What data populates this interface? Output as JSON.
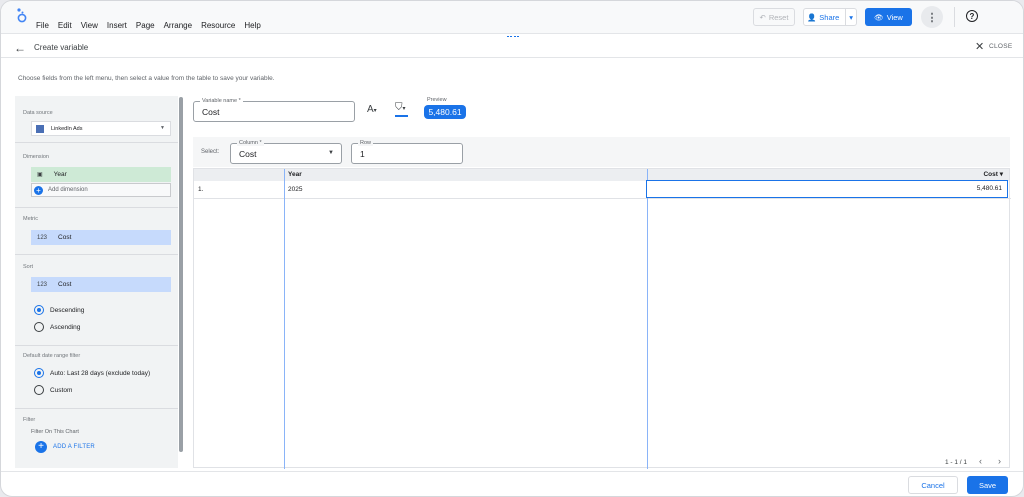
{
  "menu": [
    "File",
    "Edit",
    "View",
    "Insert",
    "Page",
    "Arrange",
    "Resource",
    "Help"
  ],
  "toolbar": {
    "reset": "Reset",
    "share": "Share",
    "view": "View",
    "help": "?"
  },
  "header": {
    "title": "Create variable",
    "close": "CLOSE"
  },
  "instructions": "Choose fields from the left menu, then select a value from the table to save your variable.",
  "left": {
    "data_source_label": "Data source",
    "data_source_value": "LinkedIn Ads",
    "dimension_label": "Dimension",
    "dimension_chip": "Year",
    "add_dimension": "Add dimension",
    "metric_label": "Metric",
    "metric_chip": "Cost",
    "sort_label": "Sort",
    "sort_chip": "Cost",
    "sort_desc": "Descending",
    "sort_asc": "Ascending",
    "date_label": "Default date range filter",
    "date_auto": "Auto",
    "date_auto_detail": "Last 28 days (exclude today)",
    "date_custom": "Custom",
    "filter_label": "Filter",
    "filter_sub": "Filter On This Chart",
    "add_filter": "ADD A FILTER",
    "type_badge": "123"
  },
  "editor": {
    "var_name_label": "Variable name *",
    "var_name_value": "Cost",
    "text_tool": "A",
    "preview_label": "Preview",
    "preview_value": "5,480.61",
    "select_label": "Select:",
    "column_label": "Column *",
    "column_value": "Cost",
    "row_label": "Row",
    "row_value": "1"
  },
  "table": {
    "headers": [
      "Year",
      "Cost ▾"
    ],
    "rows": [
      {
        "index": "1.",
        "year": "2025",
        "cost": "5,480.61"
      }
    ]
  },
  "pagination": "1 - 1 / 1",
  "footer": {
    "cancel": "Cancel",
    "save": "Save"
  },
  "colors": {
    "accent": "#1a73e8",
    "dimension_chip": "#ceead6",
    "metric_chip": "#c6dafc"
  }
}
